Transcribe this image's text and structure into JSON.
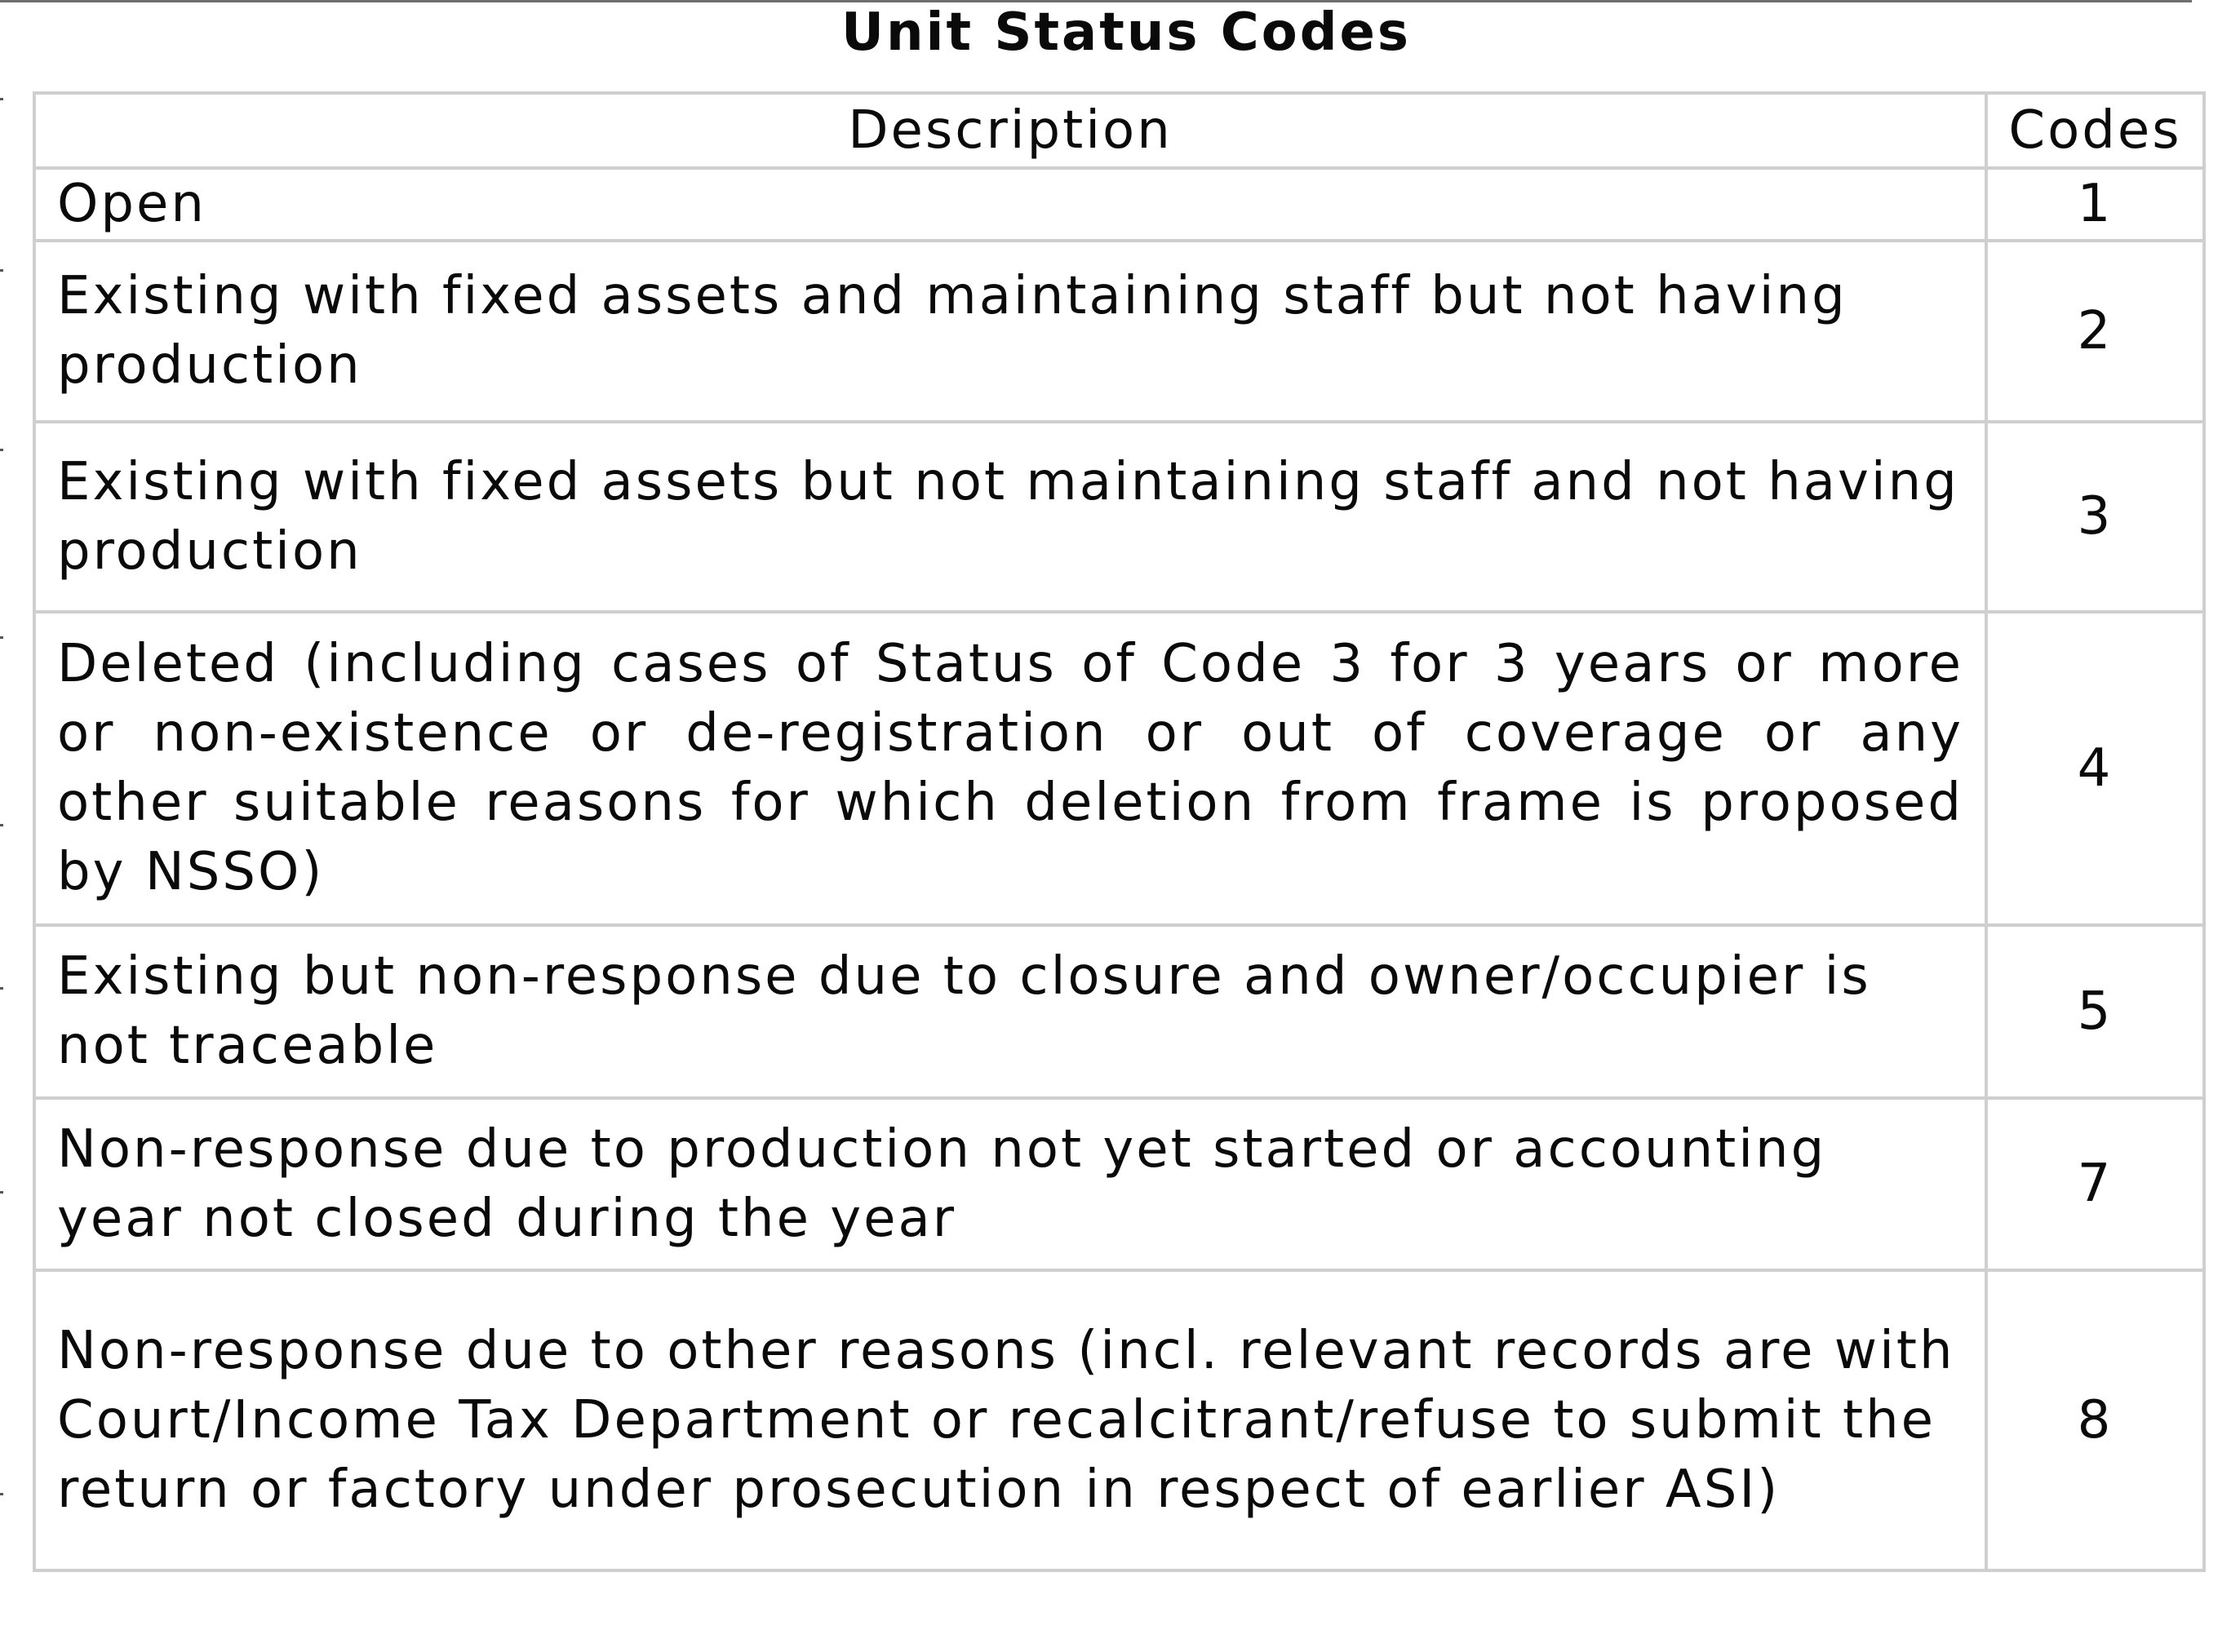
{
  "title": "Unit Status Codes",
  "table": {
    "headers": {
      "description": "Description",
      "codes": "Codes"
    },
    "rows": [
      {
        "description": "Open",
        "code": "1"
      },
      {
        "description": "Existing with fixed assets and maintaining staff but not having production",
        "code": "2"
      },
      {
        "description": "Existing with fixed assets but not maintaining staff and not having production",
        "code": "3"
      },
      {
        "description": "Deleted (including cases of Status of Code 3 for 3 years or more or non-existence or de-registration or out of coverage or any other suitable reasons for which deletion from frame is proposed by NSSO)",
        "code": "4"
      },
      {
        "description": "Existing but non-response due to closure and owner/occupier is not traceable",
        "code": "5"
      },
      {
        "description": "Non-response due to production not yet started or accounting year not closed during the year",
        "code": "7"
      },
      {
        "description": "Non-response due to other reasons (incl. relevant records are with Court/Income Tax Department or recalcitrant/refuse to submit the return or factory under prosecution in respect of earlier ASI)",
        "code": "8"
      }
    ]
  }
}
